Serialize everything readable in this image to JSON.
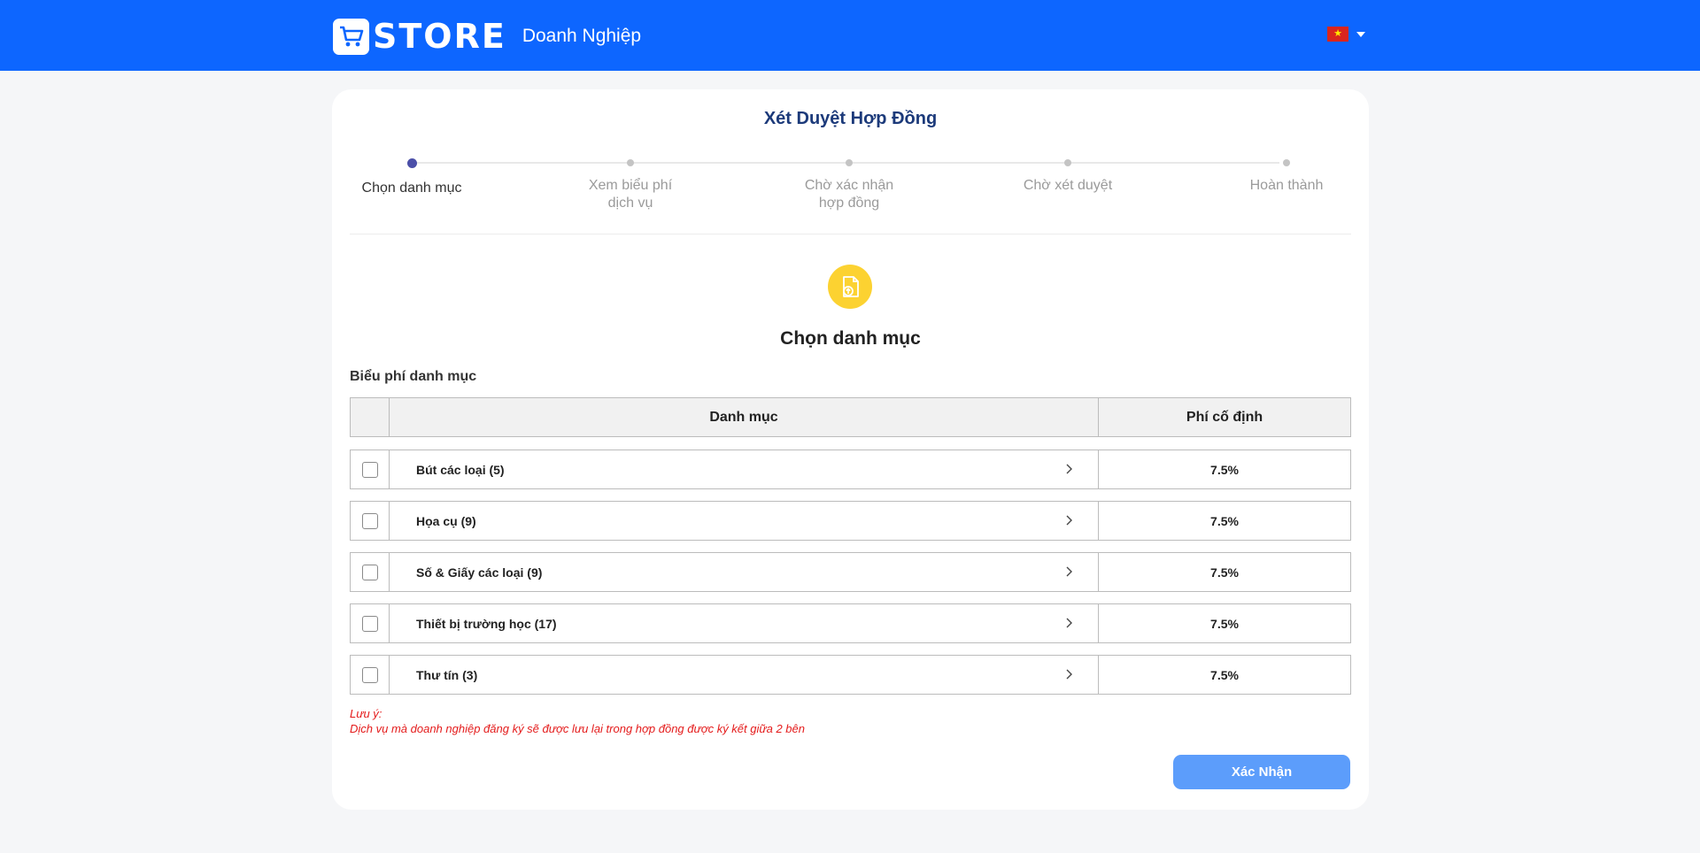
{
  "header": {
    "logo_text": "STORE",
    "subtitle": "Doanh Nghiệp",
    "language_flag": "vietnam-flag",
    "brand_color": "#0d66ff"
  },
  "page": {
    "title": "Xét Duyệt Hợp Đồng"
  },
  "stepper": {
    "steps": [
      {
        "label": "Chọn danh mục",
        "active": true
      },
      {
        "label": "Xem biểu phí dịch vụ",
        "active": false
      },
      {
        "label": "Chờ xác nhận hợp đồng",
        "active": false
      },
      {
        "label": "Chờ xét duyệt",
        "active": false
      },
      {
        "label": "Hoàn thành",
        "active": false
      }
    ]
  },
  "section": {
    "icon": "file-upload-icon",
    "title": "Chọn danh mục",
    "table_caption": "Biểu phí danh mục"
  },
  "table": {
    "headers": {
      "category": "Danh mục",
      "fee": "Phí cố định"
    },
    "rows": [
      {
        "category": "Bút các loại (5)",
        "fee": "7.5%"
      },
      {
        "category": "Họa cụ (9)",
        "fee": "7.5%"
      },
      {
        "category": "Số & Giấy các loại (9)",
        "fee": "7.5%"
      },
      {
        "category": "Thiết bị trường học (17)",
        "fee": "7.5%"
      },
      {
        "category": "Thư tín (3)",
        "fee": "7.5%"
      }
    ]
  },
  "note": {
    "label": "Lưu ý:",
    "text": "Dịch vụ mà doanh nghiệp đăng ký sẽ được lưu lại trong hợp đồng được ký kết giữa 2 bên"
  },
  "actions": {
    "confirm_label": "Xác Nhận"
  }
}
